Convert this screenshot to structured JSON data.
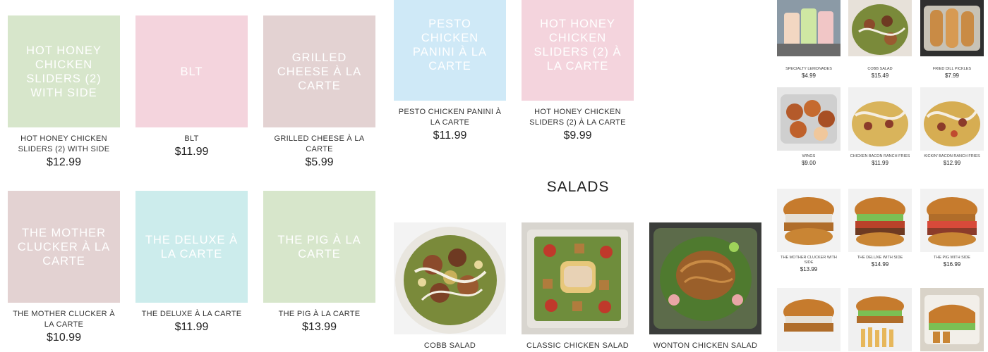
{
  "menu_left": [
    {
      "tile": "HOT HONEY CHICKEN SLIDERS (2) WITH SIDE",
      "name": "HOT HONEY CHICKEN SLIDERS (2) WITH SIDE",
      "price": "$12.99"
    },
    {
      "tile": "BLT",
      "name": "BLT",
      "price": "$11.99"
    },
    {
      "tile": "GRILLED CHEESE À LA CARTE",
      "name": "GRILLED CHEESE À LA CARTE",
      "price": "$5.99"
    },
    {
      "tile": "PESTO CHICKEN PANINI À LA CARTE",
      "name": "PESTO CHICKEN PANINI À LA CARTE",
      "price": "$11.99"
    },
    {
      "tile": "HOT HONEY CHICKEN SLIDERS (2) À LA CARTE",
      "name": "HOT HONEY CHICKEN SLIDERS (2) À LA CARTE",
      "price": "$9.99"
    },
    {
      "tile": "THE MOTHER CLUCKER À LA CARTE",
      "name": "THE MOTHER CLUCKER À LA CARTE",
      "price": "$10.99"
    },
    {
      "tile": "THE DELUXE À LA CARTE",
      "name": "THE DELUXE À LA CARTE",
      "price": "$11.99"
    },
    {
      "tile": "THE PIG À LA CARTE",
      "name": "THE PIG À LA CARTE",
      "price": "$13.99"
    }
  ],
  "salads": {
    "title": "SALADS",
    "items": [
      {
        "name": "COBB SALAD"
      },
      {
        "name": "CLASSIC CHICKEN SALAD"
      },
      {
        "name": "WONTON CHICKEN SALAD"
      }
    ]
  },
  "side_grid": [
    {
      "name": "SPECIALTY LEMONADES",
      "price": "$4.99"
    },
    {
      "name": "COBB SALAD",
      "price": "$15.49"
    },
    {
      "name": "FRIED DILL PICKLES",
      "price": "$7.99"
    },
    {
      "name": "WINGS",
      "price": "$9.00"
    },
    {
      "name": "CHICKEN BACON RANCH FRIES",
      "price": "$11.99"
    },
    {
      "name": "KICKIN' BACON RANCH FRIES",
      "price": "$12.99"
    },
    {
      "name": "THE MOTHER CLUCKER WITH SIDE",
      "price": "$13.99"
    },
    {
      "name": "THE DELUXE WITH SIDE",
      "price": "$14.99"
    },
    {
      "name": "THE PIG WITH SIDE",
      "price": "$16.99"
    }
  ]
}
